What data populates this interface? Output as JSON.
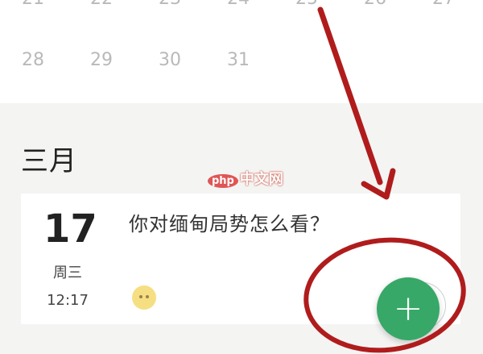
{
  "calendar": {
    "partial_week": [
      "21",
      "22",
      "23",
      "24",
      "25",
      "26",
      "27"
    ],
    "last_week": [
      "28",
      "29",
      "30",
      "31"
    ]
  },
  "month_section": {
    "title": "三月"
  },
  "note": {
    "day": "17",
    "weekday": "周三",
    "time": "12:17",
    "text": "你对缅甸局势怎么看？",
    "sticker_icon": "chick-emoji-icon"
  },
  "watermark": {
    "logo": "php",
    "text": "中文网"
  },
  "fab": {
    "icon": "plus-icon",
    "label": "+"
  },
  "colors": {
    "fab": "#37a867",
    "annotation": "#b01c1c",
    "background": "#f4f4f3"
  }
}
